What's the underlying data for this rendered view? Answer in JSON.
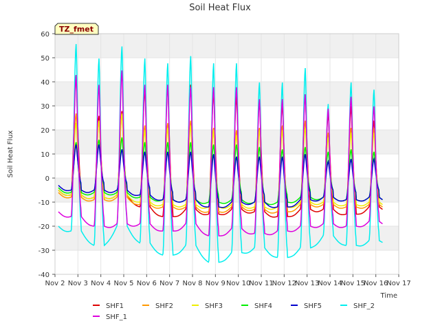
{
  "chart_data": {
    "type": "line",
    "title": "Soil Heat Flux",
    "xlabel": "Time",
    "ylabel": "Soil Heat Flux",
    "badge": "TZ_fmet",
    "xlim": [
      2,
      17
    ],
    "ylim": [
      -40,
      60
    ],
    "x_ticks": [
      {
        "v": 2,
        "label": "Nov 2"
      },
      {
        "v": 3,
        "label": "Nov 3"
      },
      {
        "v": 4,
        "label": "Nov 4"
      },
      {
        "v": 5,
        "label": "Nov 5"
      },
      {
        "v": 6,
        "label": "Nov 6"
      },
      {
        "v": 7,
        "label": "Nov 7"
      },
      {
        "v": 8,
        "label": "Nov 8"
      },
      {
        "v": 9,
        "label": "Nov 9"
      },
      {
        "v": 10,
        "label": "Nov 10"
      },
      {
        "v": 11,
        "label": "Nov 11"
      },
      {
        "v": 12,
        "label": "Nov 12"
      },
      {
        "v": 13,
        "label": "Nov 13"
      },
      {
        "v": 14,
        "label": "Nov 14"
      },
      {
        "v": 15,
        "label": "Nov 15"
      },
      {
        "v": 16,
        "label": "Nov 16"
      },
      {
        "v": 17,
        "label": "Nov 17"
      }
    ],
    "y_ticks": [
      {
        "v": -40,
        "label": "-40"
      },
      {
        "v": -30,
        "label": "-30"
      },
      {
        "v": -20,
        "label": "-20"
      },
      {
        "v": -10,
        "label": "-10"
      },
      {
        "v": 0,
        "label": "0"
      },
      {
        "v": 10,
        "label": "10"
      },
      {
        "v": 20,
        "label": "20"
      },
      {
        "v": 30,
        "label": "30"
      },
      {
        "v": 40,
        "label": "40"
      },
      {
        "v": 50,
        "label": "50"
      },
      {
        "v": 60,
        "label": "60"
      }
    ],
    "grid": true,
    "background_bands": "alternating light grey",
    "legend_position": "bottom",
    "series": [
      {
        "name": "SHF1",
        "color": "#dd0000",
        "peaks": [
          43,
          26,
          28,
          37,
          39,
          39,
          36,
          34,
          32,
          31,
          35,
          27,
          30,
          24,
          27
        ],
        "troughs": [
          -7,
          -8,
          -7,
          -12,
          -16,
          -13,
          -15,
          -13,
          -14,
          -16,
          -13,
          -13,
          -15,
          -12,
          -13
        ]
      },
      {
        "name": "SHF2",
        "color": "#ff9900",
        "peaks": [
          27,
          24,
          27,
          22,
          23,
          24,
          21,
          20,
          21,
          22,
          24,
          19,
          21,
          21,
          22
        ],
        "troughs": [
          -8,
          -9,
          -8,
          -11,
          -12,
          -12,
          -14,
          -12,
          -13,
          -14,
          -11,
          -11,
          -12,
          -11,
          -12
        ]
      },
      {
        "name": "SHF3",
        "color": "#eeee00",
        "peaks": [
          23,
          24,
          27,
          20,
          21,
          22,
          20,
          18,
          20,
          20,
          21,
          17,
          19,
          19,
          19
        ],
        "troughs": [
          -7,
          -8,
          -7,
          -10,
          -11,
          -11,
          -12,
          -11,
          -12,
          -12,
          -10,
          -10,
          -11,
          -10,
          -11
        ]
      },
      {
        "name": "SHF4",
        "color": "#00ee00",
        "peaks": [
          15,
          16,
          17,
          15,
          15,
          15,
          14,
          14,
          13,
          12,
          13,
          11,
          12,
          11,
          11
        ],
        "troughs": [
          -6,
          -6,
          -6,
          -8,
          -9,
          -9,
          -10,
          -9,
          -10,
          -10,
          -8,
          -8,
          -9,
          -8,
          -9
        ]
      },
      {
        "name": "SHF5",
        "color": "#0000cc",
        "peaks": [
          14,
          14,
          12,
          11,
          11,
          11,
          10,
          9,
          9,
          9,
          10,
          7,
          8,
          8,
          8
        ],
        "troughs": [
          -5,
          -5,
          -5,
          -7,
          -9,
          -9,
          -12,
          -10,
          -10,
          -12,
          -9,
          -8,
          -9,
          -8,
          -9
        ]
      },
      {
        "name": "SHF_2",
        "color": "#00eeee",
        "peaks": [
          56,
          50,
          55,
          50,
          48,
          51,
          48,
          48,
          40,
          40,
          46,
          31,
          40,
          37,
          37
        ],
        "troughs": [
          -22,
          -28,
          -20,
          -27,
          -32,
          -28,
          -35,
          -31,
          -29,
          -33,
          -29,
          -24,
          -28,
          -26,
          -26
        ]
      },
      {
        "name": "SHF_1",
        "color": "#dd00dd",
        "peaks": [
          43,
          39,
          45,
          39,
          39,
          38,
          38,
          38,
          33,
          33,
          35,
          29,
          34,
          30,
          30
        ],
        "troughs": [
          -16,
          -20,
          -19,
          -19,
          -22,
          -19,
          -24,
          -21,
          -23,
          -22,
          -20,
          -19,
          -20,
          -18,
          -19
        ]
      }
    ]
  }
}
